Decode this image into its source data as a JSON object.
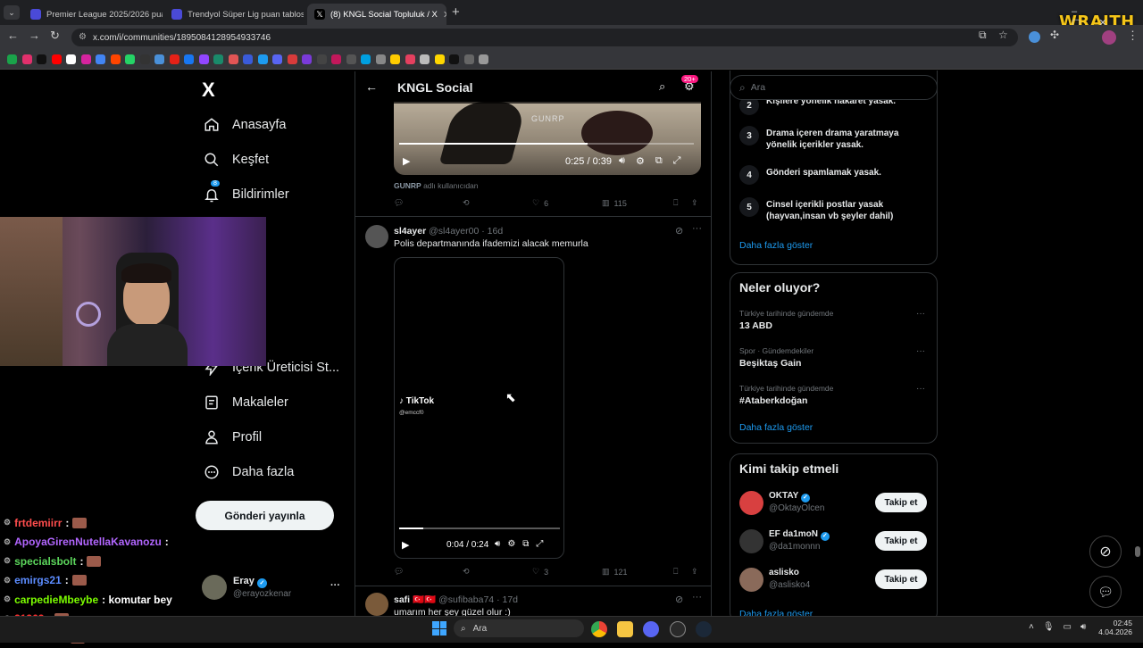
{
  "browser": {
    "tabs": [
      {
        "title": "Premier League 2025/2026 puan",
        "favicon_color": "#4a4ad8",
        "active": false
      },
      {
        "title": "Trendyol Süper Lig puan tablosu",
        "favicon_color": "#4a4ad8",
        "active": false
      },
      {
        "title": "(8) KNGL Social Topluluk / X",
        "favicon_color": "#000000",
        "active": true
      }
    ],
    "new_tab": "+",
    "url": "x.com/i/communities/1895084128954933746",
    "overlay_logo": "WRAITH",
    "bookmark_colors": [
      "#1aa34a",
      "#e1306c",
      "#111111",
      "#ff0000",
      "#ffffff",
      "#d6249f",
      "#4285f4",
      "#ff4500",
      "#25d366",
      "#333333",
      "#4a90d9",
      "#e62117",
      "#1877f2",
      "#9146ff",
      "#1a8a6a",
      "#e25555",
      "#3a5bd9",
      "#1d9bf0",
      "#5865f2",
      "#d83b3b",
      "#7a3ad9",
      "#444444",
      "#c2185b",
      "#555555",
      "#00a0e0",
      "#888888",
      "#ffcc00",
      "#e4405f",
      "#bbbbbb",
      "#ffd700",
      "#111111",
      "#666666",
      "#999999"
    ]
  },
  "x": {
    "logo": "X",
    "nav": [
      {
        "label": "Anasayfa",
        "icon": "home-icon"
      },
      {
        "label": "Keşfet",
        "icon": "search-icon"
      },
      {
        "label": "Bildirimler",
        "icon": "bell-icon",
        "badge": "8"
      },
      {
        "label": "t",
        "icon": "mail-icon"
      },
      {
        "label": "",
        "icon": "grok-icon"
      },
      {
        "label": "um",
        "icon": "bookmark-icon"
      },
      {
        "label": "retleri",
        "icon": "users-icon"
      },
      {
        "label": "İçerik Üreticisi St...",
        "icon": "lightning-icon"
      },
      {
        "label": "Makaleler",
        "icon": "article-icon"
      },
      {
        "label": "Profil",
        "icon": "person-icon"
      },
      {
        "label": "Daha fazla",
        "icon": "more-circle-icon"
      }
    ],
    "post_button": "Gönderi yayınla",
    "account": {
      "name": "Eray",
      "handle": "@erayozkenar",
      "more": "···"
    },
    "header": {
      "title": "KNGL Social",
      "badge": "20+"
    },
    "post1": {
      "video_watermark": "GUNRP",
      "time": "0:25 / 0:39",
      "progress": 0.64,
      "attribution_user": "GUNRP",
      "attribution_text": "adlı kullanıcıdan",
      "replies": "",
      "reposts": "",
      "likes": "6",
      "views": "115"
    },
    "post2": {
      "name": "sl4ayer",
      "handle": "@sl4ayer00",
      "age": "· 16d",
      "text": "Polis departmanında ifademizi alacak memurla",
      "tiktok": "TikTok",
      "tiktok_user": "@emccf0",
      "time": "0:04 / 0:24",
      "progress": 0.15,
      "likes": "3",
      "views": "121"
    },
    "post3": {
      "name": "safi",
      "flags": "🇹🇷🇹🇷",
      "handle": "@sufibaba74",
      "age": "· 17d",
      "text": "umarım her şey güzel olur :)"
    },
    "search_placeholder": "Ara",
    "rules": [
      {
        "n": "2",
        "text": "Kişilere yönelik hakaret yasak."
      },
      {
        "n": "3",
        "text": "Drama içeren drama yaratmaya yönelik içerikler yasak."
      },
      {
        "n": "4",
        "text": "Gönderi spamlamak yasak."
      },
      {
        "n": "5",
        "text": "Cinsel içerikli postlar yasak (hayvan,insan vb şeyler dahil)"
      }
    ],
    "rules_more": "Daha fazla göster",
    "trends_title": "Neler oluyor?",
    "trends": [
      {
        "context": "Türkiye tarihinde gündemde",
        "name": "13 ABD"
      },
      {
        "context": "Spor · Gündemdekiler",
        "name": "Beşiktaş Gain"
      },
      {
        "context": "Türkiye tarihinde gündemde",
        "name": "#Ataberkdoğan"
      }
    ],
    "trends_more": "Daha fazla göster",
    "follow_title": "Kimi takip etmeli",
    "follow": [
      {
        "name": "OKTAY",
        "handle": "@OktayOlcen",
        "verified": true,
        "avatar_color": "#d84040",
        "button": "Takip et"
      },
      {
        "name": "EF da1moN",
        "handle": "@da1monnn",
        "verified": true,
        "avatar_color": "#333333",
        "button": "Takip et"
      },
      {
        "name": "aslisko",
        "handle": "@aslisko4",
        "verified": false,
        "avatar_color": "#8a6a5a",
        "button": "Takip et"
      }
    ],
    "follow_more": "Daha fazla göster"
  },
  "chat": [
    {
      "user": "frtdemiirr",
      "color": "#ff4d4d",
      "msg": ":",
      "emote": true
    },
    {
      "user": "ApoyaGirenNutellaKavanozu",
      "color": "#b266ff",
      "msg": ":",
      "emote": false
    },
    {
      "user": "specialsbolt",
      "color": "#5cd65c",
      "msg": ":",
      "emote": true
    },
    {
      "user": "emirgs21",
      "color": "#5c8cff",
      "msg": ":",
      "emote": true
    },
    {
      "user": "carpedieMbeybe",
      "color": "#7cfc00",
      "msg": ": komutar bey",
      "emote": false
    },
    {
      "user": "31363",
      "color": "#ff3030",
      "msg": ":",
      "emote": true
    },
    {
      "user": "Berat541",
      "color": "#7fa3ff",
      "msg": ":",
      "emote": true
    }
  ],
  "taskbar": {
    "search": "Ara",
    "time": "02:45",
    "date": "4.04.2026"
  }
}
